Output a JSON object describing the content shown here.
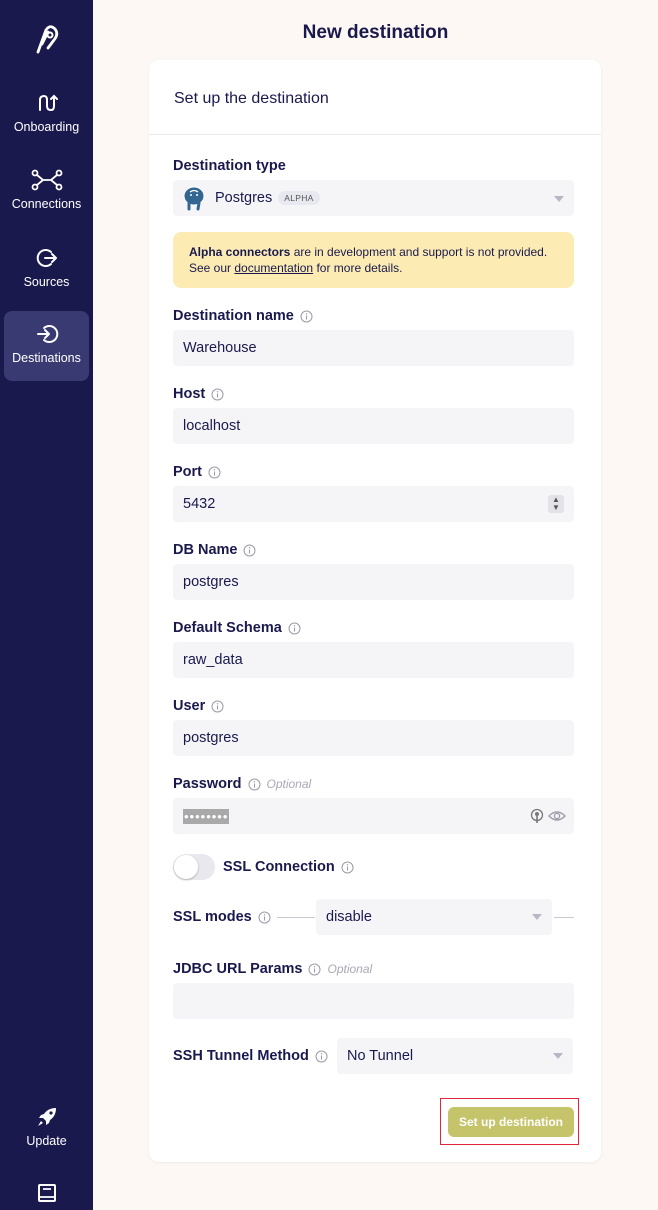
{
  "sidebar": {
    "items": [
      {
        "label": "Onboarding",
        "icon": "onboarding-icon"
      },
      {
        "label": "Connections",
        "icon": "connections-icon"
      },
      {
        "label": "Sources",
        "icon": "sources-icon"
      },
      {
        "label": "Destinations",
        "icon": "destinations-icon",
        "active": true
      }
    ],
    "update_label": "Update",
    "bottom_icon": "docs-icon"
  },
  "page": {
    "title": "New destination",
    "card_title": "Set up the destination"
  },
  "form": {
    "destination_type_label": "Destination type",
    "destination_type_value": "Postgres",
    "destination_type_badge": "ALPHA",
    "notice": {
      "bold": "Alpha connectors",
      "text1": " are in development and support is not provided. See our ",
      "link": "documentation",
      "text2": " for more details."
    },
    "destination_name_label": "Destination name",
    "destination_name_value": "Warehouse",
    "host_label": "Host",
    "host_value": "localhost",
    "port_label": "Port",
    "port_value": "5432",
    "db_name_label": "DB Name",
    "db_name_value": "postgres",
    "schema_label": "Default Schema",
    "schema_value": "raw_data",
    "user_label": "User",
    "user_value": "postgres",
    "password_label": "Password",
    "password_optional": "Optional",
    "password_mask": "••••••••",
    "ssl_label": "SSL Connection",
    "ssl_enabled": false,
    "ssl_modes_label": "SSL modes",
    "ssl_modes_value": "disable",
    "jdbc_label": "JDBC URL Params",
    "jdbc_optional": "Optional",
    "jdbc_value": "",
    "ssh_label": "SSH Tunnel Method",
    "ssh_value": "No Tunnel",
    "submit_label": "Set up destination"
  },
  "colors": {
    "sidebar_bg": "#1a194d",
    "active_nav": "#3a3a72",
    "page_bg": "#fdf8f4",
    "notice_bg": "#fcecb3",
    "submit_bg": "#c6c46a"
  }
}
